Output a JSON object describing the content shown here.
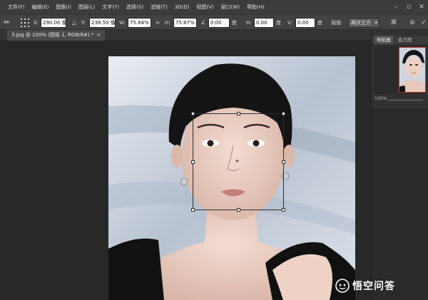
{
  "menu": [
    "文件(F)",
    "编辑(E)",
    "图像(I)",
    "图层(L)",
    "文字(Y)",
    "选择(S)",
    "滤镜(T)",
    "3D(D)",
    "视图(V)",
    "窗口(W)",
    "帮助(H)"
  ],
  "options": {
    "x_label": "X:",
    "x_value": "290.00 像",
    "y_label": "Y:",
    "y_value": "238.50 像",
    "w_label": "W:",
    "w_value": "75.84%",
    "h_label": "H:",
    "h_value": "75.87%",
    "angle_value": "0.00",
    "angle_unit": "度",
    "hskew_label": "H:",
    "hskew_value": "0.00",
    "hskew_unit": "度",
    "vskew_label": "V:",
    "vskew_value": "0.00",
    "vskew_unit": "度",
    "interp_label": "插值:",
    "interp_value": "两次立方"
  },
  "document": {
    "tab_title": "3.jpg @ 100% (图层 1, RGB/8#) *",
    "close_glyph": "×"
  },
  "panel": {
    "tab_navigator": "导航器",
    "tab_histogram": "直方图",
    "zoom": "100%"
  },
  "watermark": {
    "text": "悟空问答"
  },
  "colors": {
    "menubar": "#3c3c3c",
    "optionsbar": "#424242",
    "workspace": "#282828",
    "nav_frame": "#c0392b"
  }
}
